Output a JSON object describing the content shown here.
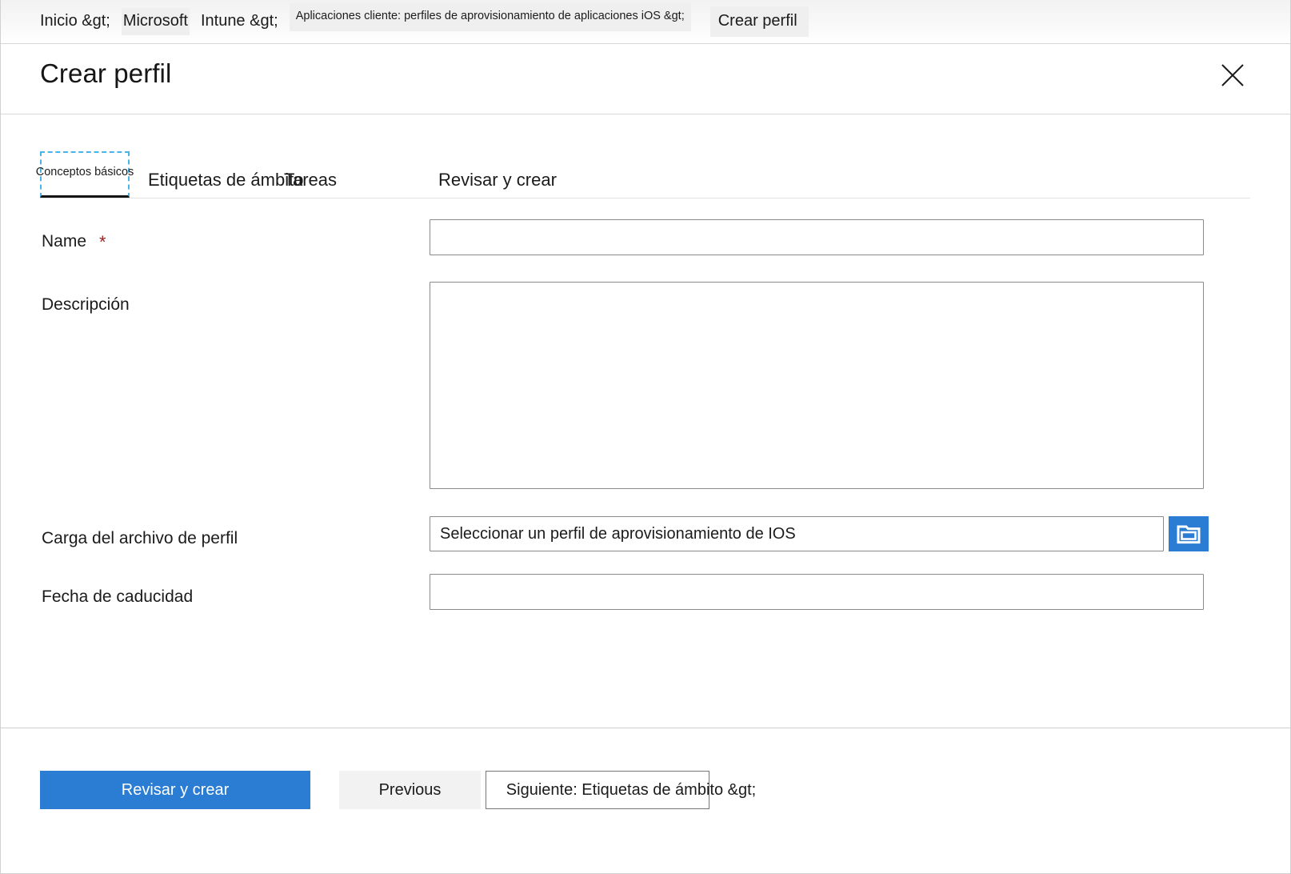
{
  "breadcrumb": {
    "items": [
      {
        "label": "Inicio &gt;",
        "shaded": false
      },
      {
        "label": "Microsoft",
        "shaded": true
      },
      {
        "label": "Intune &gt;",
        "shaded": false
      },
      {
        "label": "Aplicaciones cliente: perfiles de aprovisionamiento de aplicaciones iOS &gt;",
        "shaded": true
      },
      {
        "label": "Crear perfil",
        "shaded": true
      }
    ]
  },
  "header": {
    "title": "Crear perfil",
    "close_icon": "close-icon",
    "close_label": "Cerrar"
  },
  "tabs": [
    {
      "label": "Conceptos básicos",
      "active": true
    },
    {
      "label": "Etiquetas de ámbito",
      "active": false
    },
    {
      "label": "Tareas",
      "active": false
    },
    {
      "label": "Revisar y crear",
      "active": false
    }
  ],
  "form": {
    "name": {
      "label": "Name",
      "required_marker": "*",
      "value": "",
      "placeholder": ""
    },
    "description": {
      "label": "Descripción",
      "value": "",
      "placeholder": ""
    },
    "profile_file": {
      "label": "Carga del archivo de perfil",
      "value": "Seleccionar un perfil de aprovisionamiento de IOS",
      "placeholder": "Seleccionar un perfil de aprovisionamiento de IOS",
      "browse_icon": "folder-icon",
      "browse_label": "Examinar"
    },
    "expiry_date": {
      "label": "Fecha de caducidad",
      "value": "",
      "placeholder": ""
    }
  },
  "footer": {
    "review_create": "Revisar y crear",
    "previous": "Previous",
    "next": "Siguiente: Etiquetas de ámbito &gt;"
  },
  "colors": {
    "accent": "#2b7cd3",
    "focus_outline": "#4ab3e8",
    "required": "#9b2224",
    "border": "#8a8a8a"
  }
}
